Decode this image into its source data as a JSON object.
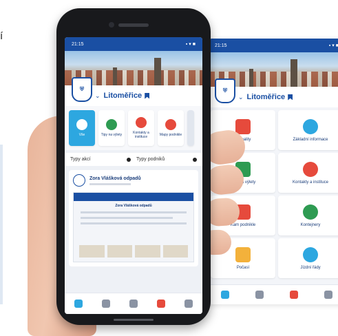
{
  "page": {
    "edge_glyph": "í"
  },
  "phone_back": {
    "status_time": "21:15",
    "status_icons": "▪ ▾ ■",
    "city_name": "Litoměřice",
    "tiles": [
      {
        "label": "Aktuality",
        "icon": "news-icon",
        "color": "#e64a3c"
      },
      {
        "label": "Základní informace",
        "icon": "info-icon",
        "color": "#2da7e0"
      },
      {
        "label": "Tipy na výlety",
        "icon": "trips-icon",
        "color": "#2e9b52"
      },
      {
        "label": "Kontakty a instituce",
        "icon": "contacts-icon",
        "color": "#e64a3c"
      },
      {
        "label": "Kam podnikle",
        "icon": "map-pin-icon",
        "color": "#e64a3c"
      },
      {
        "label": "Kontejnery",
        "icon": "recycle-icon",
        "color": "#2e9b52"
      },
      {
        "label": "Počasí",
        "icon": "weather-icon",
        "color": "#f3b13b"
      },
      {
        "label": "Jízdní řády",
        "icon": "bus-icon",
        "color": "#2da7e0"
      }
    ],
    "tabbar": [
      {
        "icon": "home-icon",
        "color": "#2da7e0"
      },
      {
        "icon": "search-icon",
        "color": "#8a93a3"
      },
      {
        "icon": "chat-icon",
        "color": "#e64a3c"
      },
      {
        "icon": "profile-icon",
        "color": "#8a93a3"
      }
    ]
  },
  "phone_front": {
    "status_time": "21:15",
    "status_icons": "▪ ▾ ■",
    "city_name": "Litoměřice",
    "quick_items": [
      {
        "label": "Vše",
        "color": "#ffffff",
        "active": true
      },
      {
        "label": "Tipy na výlety",
        "color": "#2e9b52",
        "active": false
      },
      {
        "label": "Kontakty a instituce",
        "color": "#e64a3c",
        "active": false
      },
      {
        "label": "Mapy podnikle",
        "color": "#e64a3c",
        "active": false
      }
    ],
    "filters": [
      "Typy akcí",
      "Typy podniků"
    ],
    "card_title": "Zora Vlášková odpadů",
    "doc_title": "Zora Vlášková odpadů",
    "tabbar": [
      {
        "icon": "home-icon",
        "color": "#2da7e0"
      },
      {
        "icon": "list-icon",
        "color": "#8a93a3"
      },
      {
        "icon": "search-icon",
        "color": "#8a93a3"
      },
      {
        "icon": "chat-icon",
        "color": "#e64a3c"
      },
      {
        "icon": "profile-icon",
        "color": "#8a93a3"
      }
    ]
  }
}
